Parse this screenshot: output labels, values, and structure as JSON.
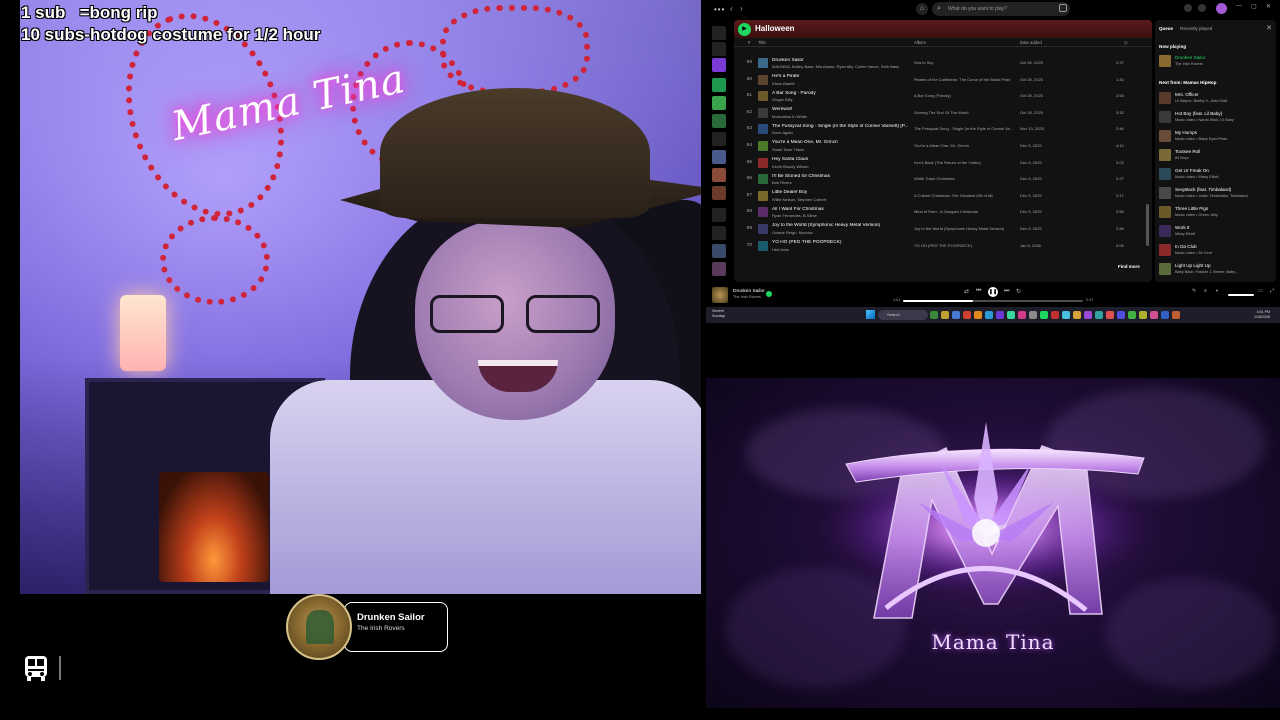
{
  "overlay": {
    "line1": "1 sub   =bong rip",
    "line2": "10 subs-hotdog costume for 1/2 hour"
  },
  "webcam": {
    "neon_sign": "Mama Tina"
  },
  "now_playing_widget": {
    "title": "Drunken Sailor",
    "artist": "The Irish Rovers"
  },
  "spotify": {
    "search_placeholder": "What do you want to play?",
    "playlist_title": "Halloween",
    "columns": {
      "num": "#",
      "title": "Title",
      "album": "Album",
      "date": "Date added"
    },
    "tracks": [
      {
        "num": "59",
        "title": "Drunken Sailor",
        "artist": "MALINDA, Bobby Bass, Mia Asano, Ryan Ally, Cullen Vance, Seth Bass",
        "album": "Sea to Sky",
        "date": "Oct 26, 2025",
        "dur": "2:37",
        "color": "#3b6b8a"
      },
      {
        "num": "60",
        "title": "He's a Pirate",
        "artist": "Klaus Badelt",
        "album": "Pirates of the Caribbean: The Curse of the Black Pearl",
        "date": "Oct 26, 2025",
        "dur": "1:30",
        "color": "#5a4630"
      },
      {
        "num": "61",
        "title": "A Bar Song - Parody",
        "artist": "Ginger Billy",
        "album": "A Bar Song (Parody)",
        "date": "Oct 26, 2025",
        "dur": "2:54",
        "color": "#6b5a2a"
      },
      {
        "num": "62",
        "title": "Werewolf",
        "artist": "Motionless In White",
        "album": "Scoring The End Of The World",
        "date": "Oct 26, 2025",
        "dur": "3:32",
        "color": "#3a3a3a"
      },
      {
        "num": "63",
        "title": "The Pussycat Song - Single (In the Style of Connie Vannett) [P...",
        "artist": "Done Again",
        "album": "The Pussycat Song - Single (In the Style of Connie Va...",
        "date": "Nov 13, 2025",
        "dur": "2:46",
        "color": "#2a4a7a"
      },
      {
        "num": "64",
        "title": "You're a Mean One, Mr. Grinch",
        "artist": "Small Town Titans",
        "album": "You're a Mean One, Mr. Grinch",
        "date": "Dec 5, 2025",
        "dur": "4:10",
        "color": "#4a7a2a"
      },
      {
        "num": "65",
        "title": "Hey Santa Claus",
        "artist": "Kevin Bloody Wilson",
        "album": "Kev's Back (The Return of the Yobbo)",
        "date": "Dec 5, 2025",
        "dur": "3:03",
        "color": "#8a2a2a"
      },
      {
        "num": "66",
        "title": "I'll Be Stoned for Christmas",
        "artist": "Bob Rivers",
        "album": "White Trash Christmas",
        "date": "Dec 5, 2025",
        "dur": "2:27",
        "color": "#2a6a3a"
      },
      {
        "num": "67",
        "title": "Little Dealer Boy",
        "artist": "Willie Nelson, Stephen Colbert",
        "album": "A Colbert Christmas: The Greatest Gift of All!",
        "date": "Dec 5, 2025",
        "dur": "2:17",
        "color": "#7a6a2a"
      },
      {
        "num": "68",
        "title": "All I Want For Christmas",
        "artist": "Ryan Ferrandes, B-Slime",
        "album": "Mind of Ram - A Gangsta Christmas",
        "date": "Dec 5, 2025",
        "dur": "2:56",
        "color": "#5a2a6a"
      },
      {
        "num": "69",
        "title": "Joy to the World (Symphonic Heavy Metal Version)",
        "artist": "Octane Reign, Mondox",
        "album": "Joy to the World (Symphonic Heavy Metal Version)",
        "date": "Dec 5, 2025",
        "dur": "2:56",
        "color": "#3a3a6a"
      },
      {
        "num": "70",
        "title": "YO HO (PEG THE POOPDECK)",
        "artist": "Hed boss",
        "album": "YO HO (PEG THE POOPDECK)",
        "date": "Jan 6, 2026",
        "dur": "2:06",
        "color": "#1a5a6a"
      }
    ],
    "find_more": "Find more",
    "queue": {
      "tab_queue": "Queue",
      "tab_recent": "Recently played",
      "now_playing_label": "Now playing",
      "now_playing": {
        "title": "Drunken Sailor",
        "artist": "The Irish Rovers",
        "color": "#8a6a2f"
      },
      "next_label": "Next from: Mamas HipHop",
      "items": [
        {
          "title": "Mrs. Officer",
          "artist": "Lil Wayne, Bobby V., Kidd Kidd",
          "color": "#5a3a2a"
        },
        {
          "title": "Hot Boy (feat. Lil Baby)",
          "artist": "Music video • Nardo Wick, Lil Baby",
          "color": "#3a3a3a"
        },
        {
          "title": "My Humps",
          "artist": "Music video • Black Eyed Peas",
          "color": "#6a4a3a"
        },
        {
          "title": "Tootsee Roll",
          "artist": "69 Boyz",
          "color": "#7a6a3a"
        },
        {
          "title": "Get Ur Freak On",
          "artist": "Music video • Missy Elliott",
          "color": "#2a4a5a"
        },
        {
          "title": "SexyBack (feat. Timbaland)",
          "artist": "Music video • Justin Timberlake, Timbaland",
          "color": "#4a4a4a"
        },
        {
          "title": "Three Little Pigs",
          "artist": "Music video • Green Jelly",
          "color": "#6a5a2a"
        },
        {
          "title": "Work It",
          "artist": "Missy Elliott",
          "color": "#3a2a5a"
        },
        {
          "title": "In Da Club",
          "artist": "Music video • 50 Cent",
          "color": "#8a2a2a"
        },
        {
          "title": "Light Up Light Up",
          "artist": "Baby Bash, Frankie J, Berner, Baby...",
          "color": "#5a6a3a"
        }
      ]
    },
    "player": {
      "title": "Drunken Sailor",
      "artist": "The Irish Rovers",
      "current_time": "1:01",
      "total_time": "2:37",
      "progress": 0.39
    }
  },
  "taskbar": {
    "weather_line1": "Severe",
    "weather_line2": "Sunday",
    "search": "Search",
    "time": "4:51 PM",
    "date": "1/18/2026"
  },
  "logo": {
    "name": "Mama Tina"
  }
}
